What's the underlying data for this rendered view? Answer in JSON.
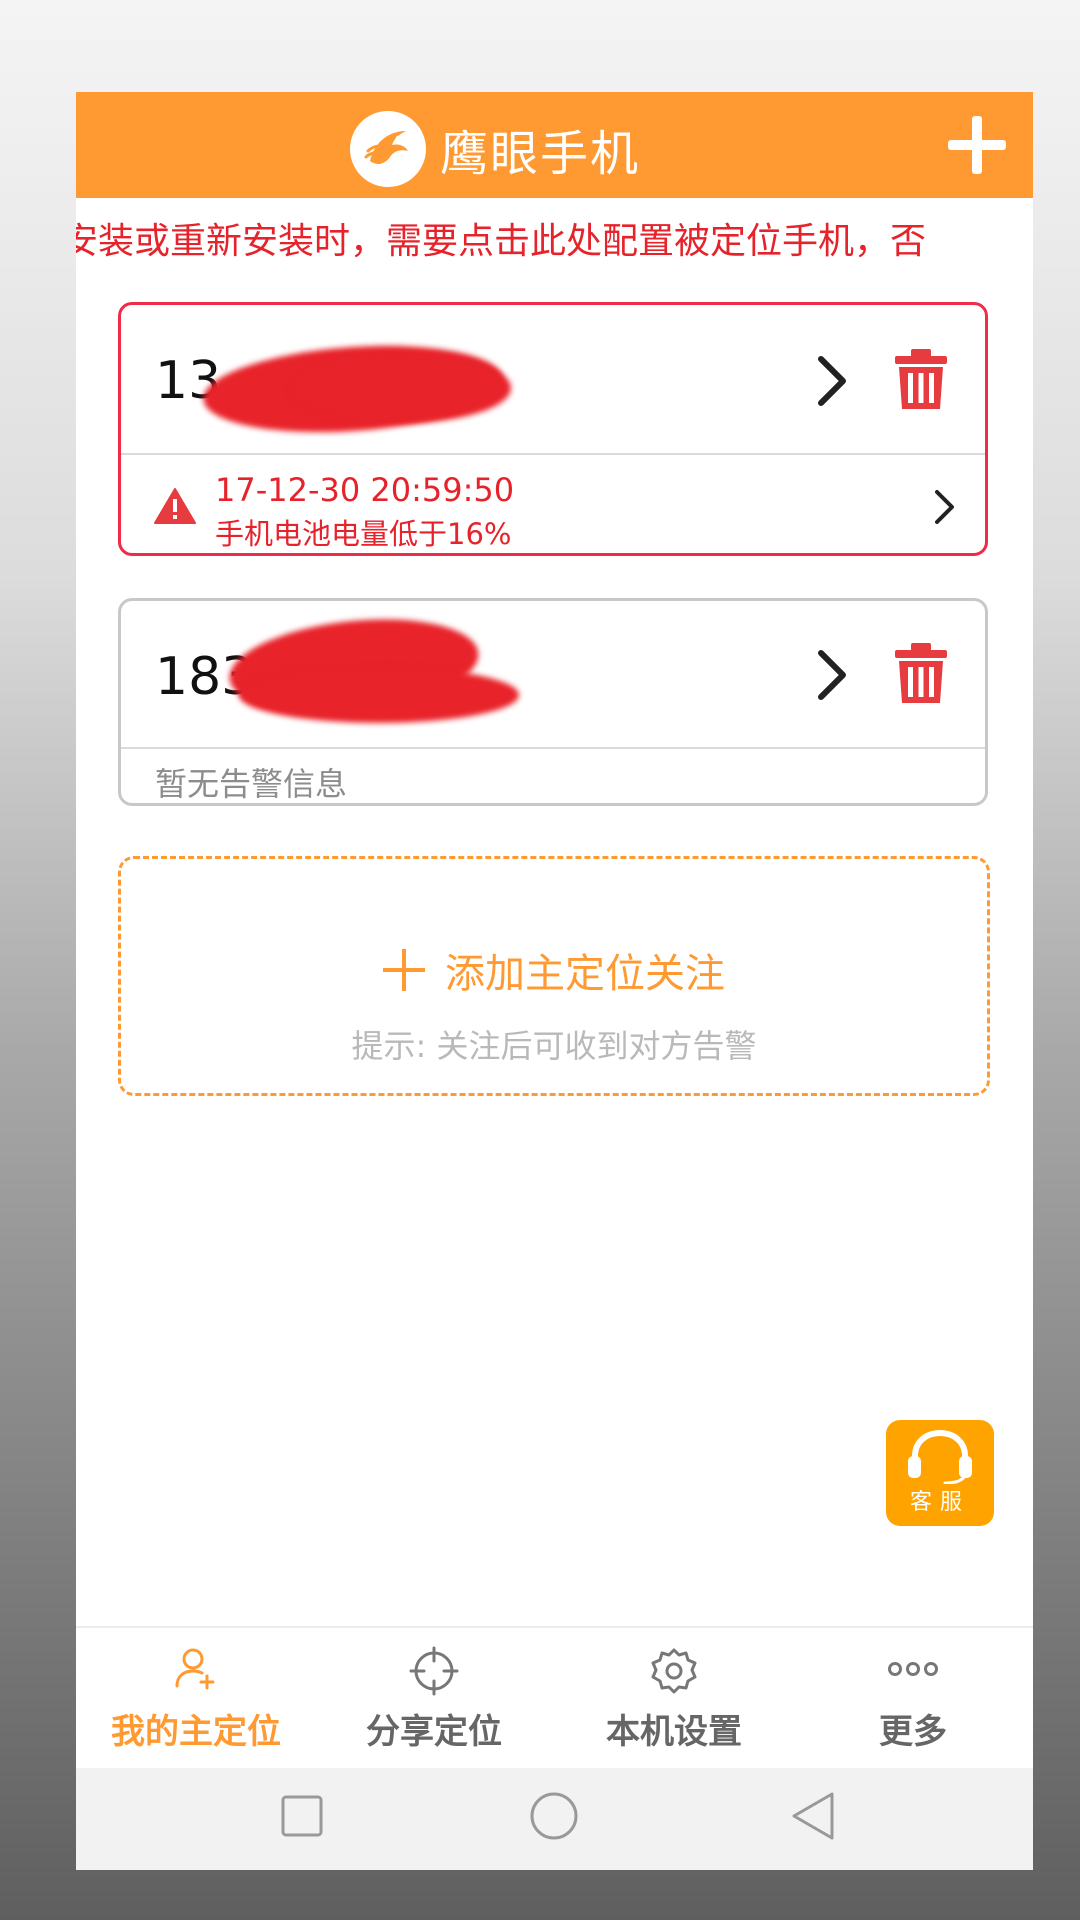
{
  "header": {
    "title": "鹰眼手机",
    "add_icon": "plus-icon",
    "colors": {
      "primary": "#ff9a33",
      "alert": "#e6222b"
    }
  },
  "notice": {
    "text": "安装或重新安装时，需要点击此处配置被定位手机，否"
  },
  "devices": [
    {
      "number_visible": "13",
      "status": "alert",
      "alert_time": "17-12-30 20:59:50",
      "alert_message": "手机电池电量低于16%"
    },
    {
      "number_visible": "183",
      "status": "none",
      "no_alert_text": "暂无告警信息"
    }
  ],
  "add_follow": {
    "label": "添加主定位关注",
    "hint": "提示: 关注后可收到对方告警"
  },
  "customer_service": {
    "label": "客服"
  },
  "tabs": [
    {
      "label": "我的主定位",
      "icon": "person-add-icon",
      "active": true
    },
    {
      "label": "分享定位",
      "icon": "crosshair-icon",
      "active": false
    },
    {
      "label": "本机设置",
      "icon": "gear-icon",
      "active": false
    },
    {
      "label": "更多",
      "icon": "more-dots-icon",
      "active": false
    }
  ],
  "system_nav": {
    "buttons": [
      "recents-icon",
      "home-icon",
      "back-icon"
    ]
  }
}
